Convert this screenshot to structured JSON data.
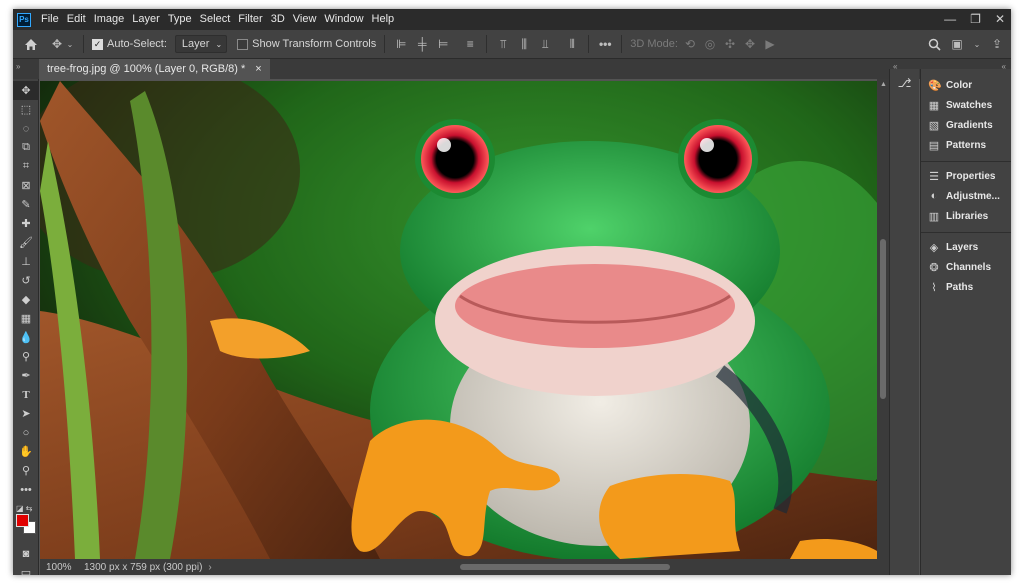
{
  "menubar": {
    "logo": "Ps",
    "items": [
      "File",
      "Edit",
      "Image",
      "Layer",
      "Type",
      "Select",
      "Filter",
      "3D",
      "View",
      "Window",
      "Help"
    ]
  },
  "optbar": {
    "auto_select_label": "Auto-Select:",
    "auto_select_target": "Layer",
    "show_transform_label": "Show Transform Controls",
    "mode_3d_label": "3D Mode:"
  },
  "document": {
    "tab_title": "tree-frog.jpg @ 100% (Layer 0, RGB/8) *",
    "close": "×"
  },
  "status": {
    "zoom": "100%",
    "doc_info": "1300 px x 759 px (300 ppi)"
  },
  "panels": {
    "group1": [
      "Color",
      "Swatches",
      "Gradients",
      "Patterns"
    ],
    "group2": [
      "Properties",
      "Adjustme...",
      "Libraries"
    ],
    "group3": [
      "Layers",
      "Channels",
      "Paths"
    ]
  },
  "colors": {
    "foreground": "#e00000",
    "background": "#ffffff",
    "accent": "#31a8ff"
  }
}
